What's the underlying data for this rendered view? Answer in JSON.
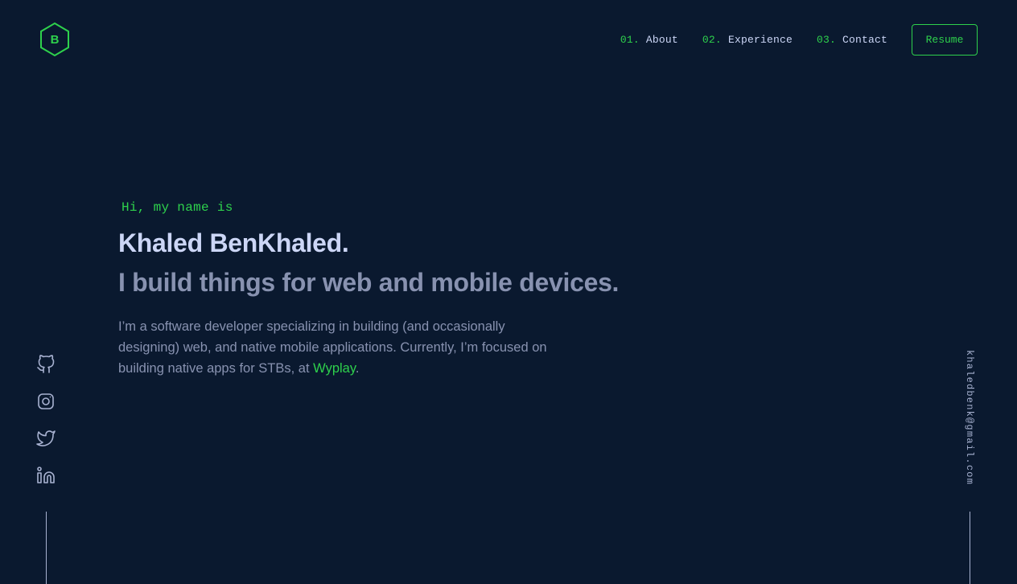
{
  "brand": {
    "logo_letter": "B"
  },
  "nav": {
    "items": [
      {
        "num": "01.",
        "label": "About"
      },
      {
        "num": "02.",
        "label": "Experience"
      },
      {
        "num": "03.",
        "label": "Contact"
      }
    ],
    "resume_label": "Resume"
  },
  "hero": {
    "intro": "Hi, my name is",
    "name": "Khaled BenKhaled.",
    "tagline": "I build things for web and mobile devices.",
    "bio_text": "I’m a software developer specializing in building (and occasionally designing) web, and native mobile applications. Currently, I’m focused on building native apps for STBs, at ",
    "bio_link": "Wyplay",
    "bio_end": "."
  },
  "socials": {
    "items": [
      {
        "icon": "github-icon"
      },
      {
        "icon": "instagram-icon"
      },
      {
        "icon": "twitter-icon"
      },
      {
        "icon": "linkedin-icon"
      }
    ]
  },
  "contact": {
    "email": "khaledbenk@gmail.com"
  },
  "colors": {
    "background": "#0a192f",
    "accent": "#2ed14c",
    "heading": "#ccd6f6",
    "muted": "#8892b0"
  }
}
